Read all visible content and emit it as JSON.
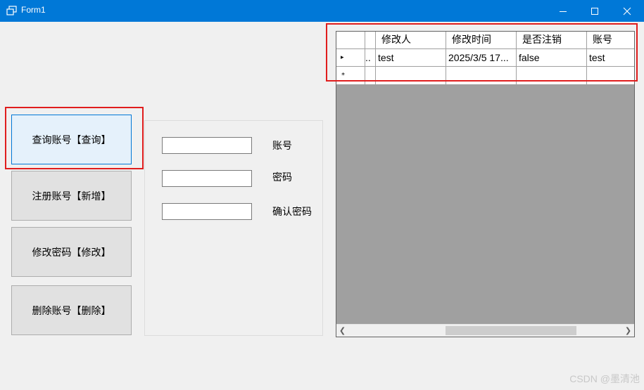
{
  "window": {
    "title": "Form1",
    "icon": "window-app-icon",
    "controls": [
      "minimize-icon",
      "maximize-icon",
      "close-icon"
    ]
  },
  "sidebar": {
    "buttons": [
      {
        "label": "查询账号【查询】",
        "active": true
      },
      {
        "label": "注册账号【新增】",
        "active": false
      },
      {
        "label": "修改密码【修改】",
        "active": false
      },
      {
        "label": "删除账号【删除】",
        "active": false
      }
    ]
  },
  "form": {
    "fields": [
      {
        "label": "账号",
        "value": ""
      },
      {
        "label": "密码",
        "value": ""
      },
      {
        "label": "确认密码",
        "value": ""
      }
    ]
  },
  "grid": {
    "columns": [
      "",
      "",
      "修改人",
      "修改时间",
      "是否注销",
      "账号"
    ],
    "rows": [
      {
        "marker": "▸",
        "cells": [
          "..",
          "test",
          "2025/3/5 17...",
          "false",
          "test"
        ]
      }
    ],
    "new_row_marker": "*"
  },
  "highlight_color": "#e01d1d",
  "accent_color": "#0078d7",
  "watermark": "CSDN @墨清池"
}
